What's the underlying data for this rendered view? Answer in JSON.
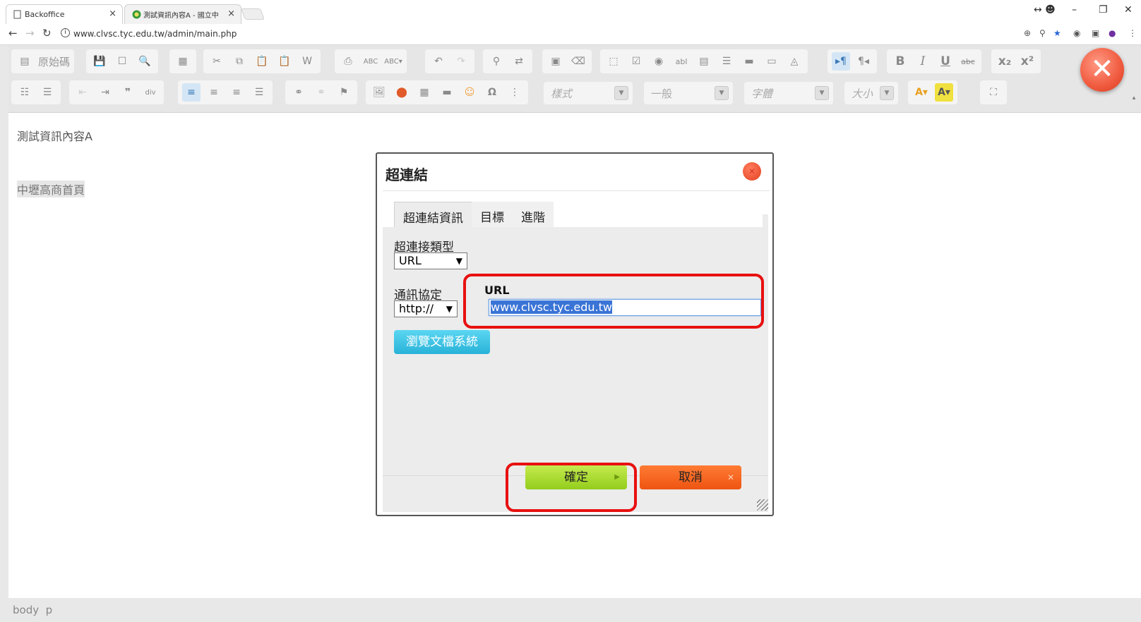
{
  "browser": {
    "tabs": [
      {
        "title": "Backoffice",
        "active": true
      },
      {
        "title": "測試資訊內容A - 國立中",
        "active": false
      }
    ],
    "url": "www.clvsc.tyc.edu.tw/admin/main.php"
  },
  "toolbar": {
    "source_label": "原始碼",
    "style_combo": "樣式",
    "format_combo": "一般",
    "font_combo": "字體",
    "size_combo": "大小"
  },
  "content": {
    "line1": "測試資訊內容A",
    "link_text": "中壢高商首頁"
  },
  "statusbar": {
    "path": "body  p"
  },
  "dialog": {
    "title": "超連結",
    "tabs": [
      "超連結資訊",
      "目標",
      "進階"
    ],
    "link_type_label": "超連接類型",
    "link_type_value": "URL",
    "protocol_label": "通訊協定",
    "protocol_value": "http://",
    "url_label": "URL",
    "url_value": "www.clvsc.tyc.edu.tw",
    "browse_button": "瀏覽文檔系統",
    "ok_button": "確定",
    "cancel_button": "取消"
  },
  "colors": {
    "ok": "#9bd22a",
    "cancel": "#f06020",
    "browse": "#3cc4e6",
    "highlight": "#e81010"
  }
}
